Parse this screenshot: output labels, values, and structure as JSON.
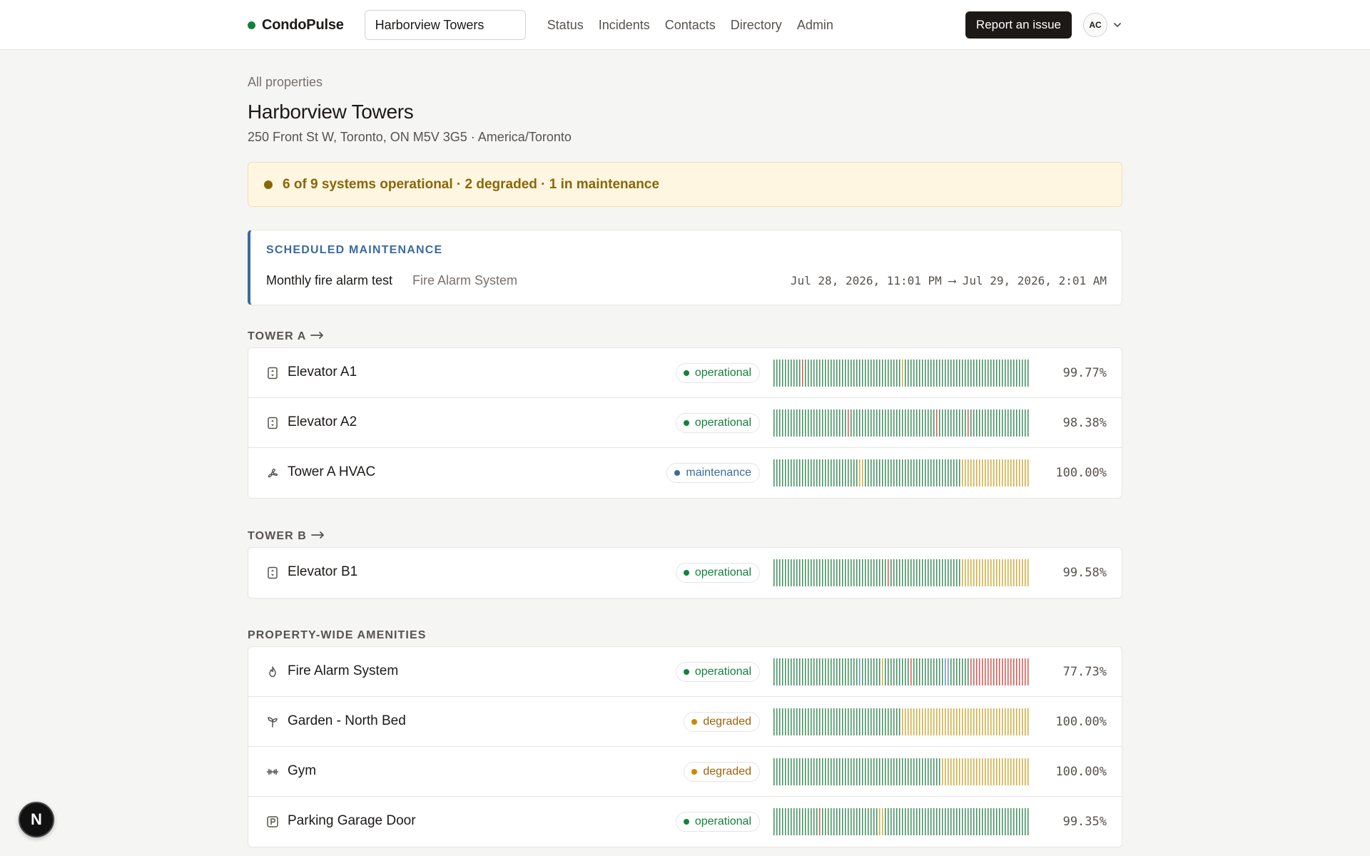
{
  "app": {
    "brand": "CondoPulse",
    "property_selector": "Harborview Towers",
    "nav": [
      "Status",
      "Incidents",
      "Contacts",
      "Directory",
      "Admin"
    ],
    "report_button": "Report an issue",
    "avatar_initials": "AC",
    "dev_badge": "N"
  },
  "page": {
    "breadcrumb": "All properties",
    "title": "Harborview Towers",
    "address": "250 Front St W, Toronto, ON M5V 3G5 · America/Toronto",
    "summary": "6 of 9 systems operational · 2 degraded · 1 in maintenance"
  },
  "maintenance": {
    "heading": "SCHEDULED MAINTENANCE",
    "title": "Monthly fire alarm test",
    "system": "Fire Alarm System",
    "window": "Jul 28, 2026, 11:01 PM ⟶ Jul 29, 2026, 2:01 AM"
  },
  "colors": {
    "operational": "#15803d",
    "degraded": "#ca8a04",
    "maintenance": "#3b6a9e",
    "bar_up": "#3f8f5c",
    "bar_degraded": "#d3aa3d",
    "bar_down": "#d9544f",
    "bar_maintenance": "#6b8fc2"
  },
  "sections": [
    {
      "label": "TOWER A",
      "has_arrow": true,
      "systems": [
        {
          "name": "Elevator A1",
          "icon": "elevator-icon",
          "status": "operational",
          "uptime": "99.77%",
          "history": {
            "length": 90,
            "degraded": [
              45
            ],
            "down": [
              10
            ],
            "maintenance": []
          }
        },
        {
          "name": "Elevator A2",
          "icon": "elevator-icon",
          "status": "operational",
          "uptime": "98.38%",
          "history": {
            "length": 90,
            "degraded": [],
            "down": [
              26,
              57,
              68
            ],
            "maintenance": []
          }
        },
        {
          "name": "Tower A HVAC",
          "icon": "fan-icon",
          "status": "maintenance",
          "uptime": "100.00%",
          "history": {
            "length": 90,
            "degraded": [
              30,
              31,
              66,
              67,
              68,
              69,
              70,
              71,
              72,
              73,
              74,
              75,
              76,
              77,
              78,
              79,
              80,
              81,
              82,
              83,
              84,
              85,
              86,
              87,
              88,
              89
            ],
            "down": [],
            "maintenance": []
          }
        }
      ]
    },
    {
      "label": "TOWER B",
      "has_arrow": true,
      "systems": [
        {
          "name": "Elevator B1",
          "icon": "elevator-icon",
          "status": "operational",
          "uptime": "99.58%",
          "history": {
            "length": 90,
            "degraded": [
              66,
              67,
              68,
              69,
              70,
              71,
              72,
              73,
              74,
              75,
              76,
              77,
              78,
              79,
              80,
              81,
              82,
              83,
              84,
              85,
              86,
              87,
              88,
              89
            ],
            "down": [
              40
            ],
            "maintenance": []
          }
        }
      ]
    },
    {
      "label": "PROPERTY-WIDE AMENITIES",
      "has_arrow": false,
      "systems": [
        {
          "name": "Fire Alarm System",
          "icon": "flame-icon",
          "status": "operational",
          "uptime": "77.73%",
          "history": {
            "length": 90,
            "degraded": [
              38
            ],
            "down": [
              48,
              69,
              70,
              71,
              72,
              73,
              74,
              75,
              76,
              77,
              78,
              79,
              80,
              81,
              82,
              83,
              84,
              85,
              86,
              87,
              88,
              89
            ],
            "maintenance": [
              30,
              60,
              61
            ]
          }
        },
        {
          "name": "Garden - North Bed",
          "icon": "sprout-icon",
          "status": "degraded",
          "uptime": "100.00%",
          "history": {
            "length": 90,
            "degraded": [
              45,
              46,
              47,
              48,
              49,
              50,
              51,
              52,
              53,
              54,
              55,
              56,
              57,
              58,
              59,
              60,
              61,
              62,
              63,
              64,
              65,
              66,
              67,
              68,
              69,
              70,
              71,
              72,
              73,
              74,
              75,
              76,
              77,
              78,
              79,
              80,
              81,
              82,
              83,
              84,
              85,
              86,
              87,
              88,
              89
            ],
            "down": [],
            "maintenance": []
          }
        },
        {
          "name": "Gym",
          "icon": "dumbbell-icon",
          "status": "degraded",
          "uptime": "100.00%",
          "history": {
            "length": 90,
            "degraded": [
              59,
              60,
              61,
              62,
              63,
              64,
              65,
              66,
              67,
              68,
              69,
              70,
              71,
              72,
              73,
              74,
              75,
              76,
              77,
              78,
              79,
              80,
              81,
              82,
              83,
              84,
              85,
              86,
              87,
              88,
              89
            ],
            "down": [],
            "maintenance": []
          }
        },
        {
          "name": "Parking Garage Door",
          "icon": "parking-icon",
          "status": "operational",
          "uptime": "99.35%",
          "history": {
            "length": 90,
            "degraded": [
              37,
              38
            ],
            "down": [
              16
            ],
            "maintenance": []
          }
        }
      ]
    }
  ]
}
